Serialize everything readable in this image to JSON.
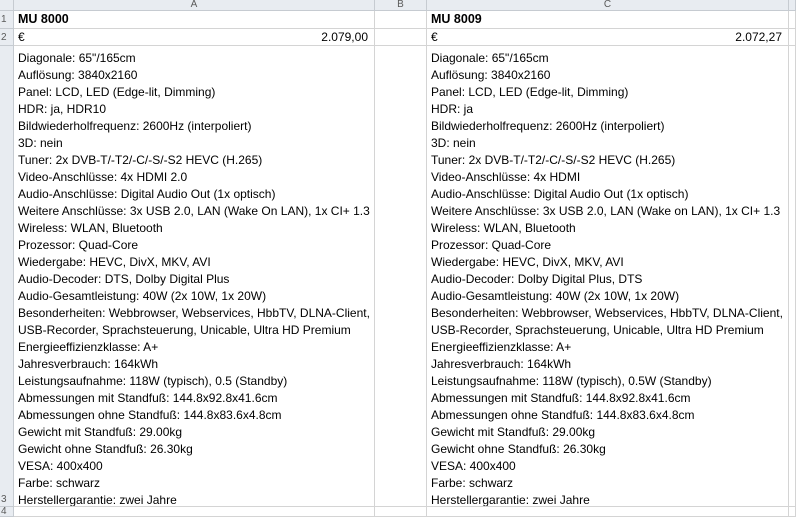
{
  "columns": [
    "A",
    "B",
    "C"
  ],
  "rows": [
    "1",
    "2",
    "3",
    "4"
  ],
  "productA": {
    "model": "MU 8000",
    "currency": "€",
    "price": "2.079,00",
    "specs": [
      "Diagonale: 65\"/165cm",
      "Auflösung: 3840x2160",
      "Panel: LCD, LED (Edge-lit, Dimming)",
      "HDR: ja, HDR10",
      "Bildwiederholfrequenz: 2600Hz (interpoliert)",
      "3D: nein",
      "Tuner: 2x DVB-T/-T2/-C/-S/-S2 HEVC (H.265)",
      "Video-Anschlüsse: 4x HDMI 2.0",
      "Audio-Anschlüsse: Digital Audio Out (1x optisch)",
      "Weitere Anschlüsse: 3x USB 2.0, LAN (Wake On LAN), 1x CI+ 1.3",
      "Wireless: WLAN, Bluetooth",
      "Prozessor: Quad-Core",
      "Wiedergabe: HEVC, DivX, MKV, AVI",
      "Audio-Decoder: DTS, Dolby Digital Plus",
      "Audio-Gesamtleistung: 40W (2x 10W, 1x 20W)",
      "Besonderheiten: Webbrowser, Webservices, HbbTV, DLNA-Client,",
      "USB-Recorder, Sprachsteuerung, Unicable, Ultra HD Premium",
      "Energieeffizienzklasse: A+",
      "Jahresverbrauch: 164kWh",
      "Leistungsaufnahme: 118W (typisch), 0.5 (Standby)",
      "Abmessungen mit Standfuß: 144.8x92.8x41.6cm",
      "Abmessungen ohne Standfuß: 144.8x83.6x4.8cm",
      "Gewicht mit Standfuß: 29.00kg",
      "Gewicht ohne Standfuß: 26.30kg",
      "VESA: 400x400",
      "Farbe: schwarz",
      "Herstellergarantie: zwei Jahre"
    ]
  },
  "productC": {
    "model": "MU 8009",
    "currency": "€",
    "price": "2.072,27",
    "specs": [
      "Diagonale: 65\"/165cm",
      "Auflösung: 3840x2160",
      "Panel: LCD, LED (Edge-lit, Dimming)",
      "HDR: ja",
      "Bildwiederholfrequenz: 2600Hz (interpoliert)",
      "3D: nein",
      "Tuner: 2x DVB-T/-T2/-C/-S/-S2 HEVC (H.265)",
      "Video-Anschlüsse: 4x HDMI",
      "Audio-Anschlüsse: Digital Audio Out (1x optisch)",
      "Weitere Anschlüsse: 3x USB 2.0, LAN (Wake on LAN), 1x CI+ 1.3",
      "Wireless: WLAN, Bluetooth",
      "Prozessor: Quad-Core",
      "Wiedergabe: HEVC, DivX, MKV, AVI",
      "Audio-Decoder: Dolby Digital Plus, DTS",
      "Audio-Gesamtleistung: 40W (2x 10W, 1x 20W)",
      "Besonderheiten: Webbrowser, Webservices, HbbTV, DLNA-Client,",
      "USB-Recorder, Sprachsteuerung, Unicable, Ultra HD Premium",
      "Energieeffizienzklasse: A+",
      "Jahresverbrauch: 164kWh",
      "Leistungsaufnahme: 118W (typisch), 0.5W (Standby)",
      "Abmessungen mit Standfuß: 144.8x92.8x41.6cm",
      "Abmessungen ohne Standfuß: 144.8x83.6x4.8cm",
      "Gewicht mit Standfuß: 29.00kg",
      "Gewicht ohne Standfuß: 26.30kg",
      "VESA: 400x400",
      "Farbe: schwarz",
      "Herstellergarantie: zwei Jahre"
    ]
  }
}
